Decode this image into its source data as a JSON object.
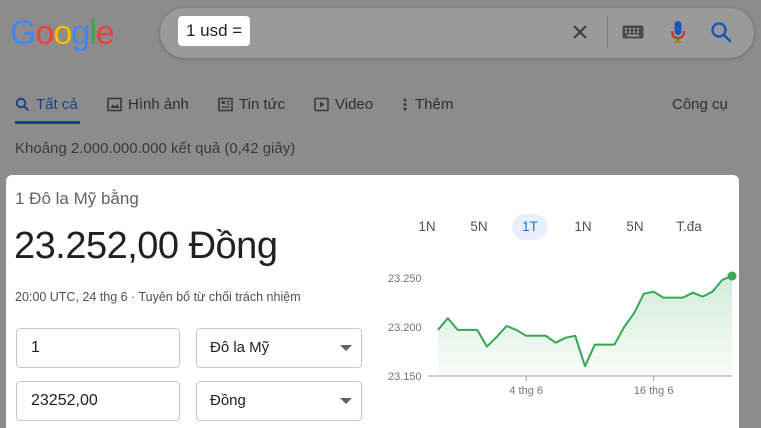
{
  "logo": {
    "letters": [
      "G",
      "o",
      "o",
      "g",
      "l",
      "e"
    ],
    "colors": [
      "#4285f4",
      "#ea4335",
      "#fbbc05",
      "#4285f4",
      "#34a853",
      "#ea4335"
    ]
  },
  "search": {
    "query": "1 usd ="
  },
  "icons": {
    "clear": "close-icon",
    "keyboard": "keyboard-icon",
    "voice": "microphone-icon",
    "search": "search-icon"
  },
  "tabs": [
    {
      "label": "Tất cả",
      "icon": "search-icon",
      "active": true
    },
    {
      "label": "Hình ảnh",
      "icon": "image-icon"
    },
    {
      "label": "Tin tức",
      "icon": "news-icon"
    },
    {
      "label": "Video",
      "icon": "play-icon"
    },
    {
      "label": "Thêm",
      "icon": "more-vert-icon"
    }
  ],
  "tools_label": "Công cụ",
  "results_count": "Khoảng 2.000.000.000 kết quả (0,42 giây)",
  "converter": {
    "subtitle": "1 Đô la Mỹ bằng",
    "result": "23.252,00 Đồng",
    "timestamp": "20:00 UTC, 24 thg 6 · Tuyên bố từ chối trách nhiệm",
    "amount_from": "1",
    "currency_from": "Đô la Mỹ",
    "amount_to": "23252,00",
    "currency_to": "Đồng"
  },
  "colors": {
    "accent": "#1a73e8",
    "chart_line": "#34a853",
    "active_tab": "#1a3e8a"
  },
  "ranges": [
    {
      "label": "1N"
    },
    {
      "label": "5N"
    },
    {
      "label": "1T",
      "active": true
    },
    {
      "label": "1N"
    },
    {
      "label": "5N"
    },
    {
      "label": "T.đa"
    }
  ],
  "chart_data": {
    "type": "area",
    "x_ticks": [
      "4 thg 6",
      "16 thg 6"
    ],
    "y_ticks": [
      "23.250",
      "23.200",
      "23.150"
    ],
    "ylim": [
      23150,
      23250
    ],
    "y_tick_values": [
      23250,
      23200,
      23150
    ],
    "values": [
      23197,
      23209,
      23197,
      23197,
      23197,
      23180,
      23190,
      23201,
      23197,
      23191,
      23191,
      23191,
      23184,
      23189,
      23191,
      23160,
      23182,
      23182,
      23182,
      23200,
      23214,
      23234,
      23236,
      23230,
      23230,
      23230,
      23235,
      23231,
      23236,
      23248,
      23252
    ],
    "x_tick_indices": [
      9,
      22
    ],
    "grid": false,
    "series": [
      {
        "values": []
      }
    ]
  }
}
